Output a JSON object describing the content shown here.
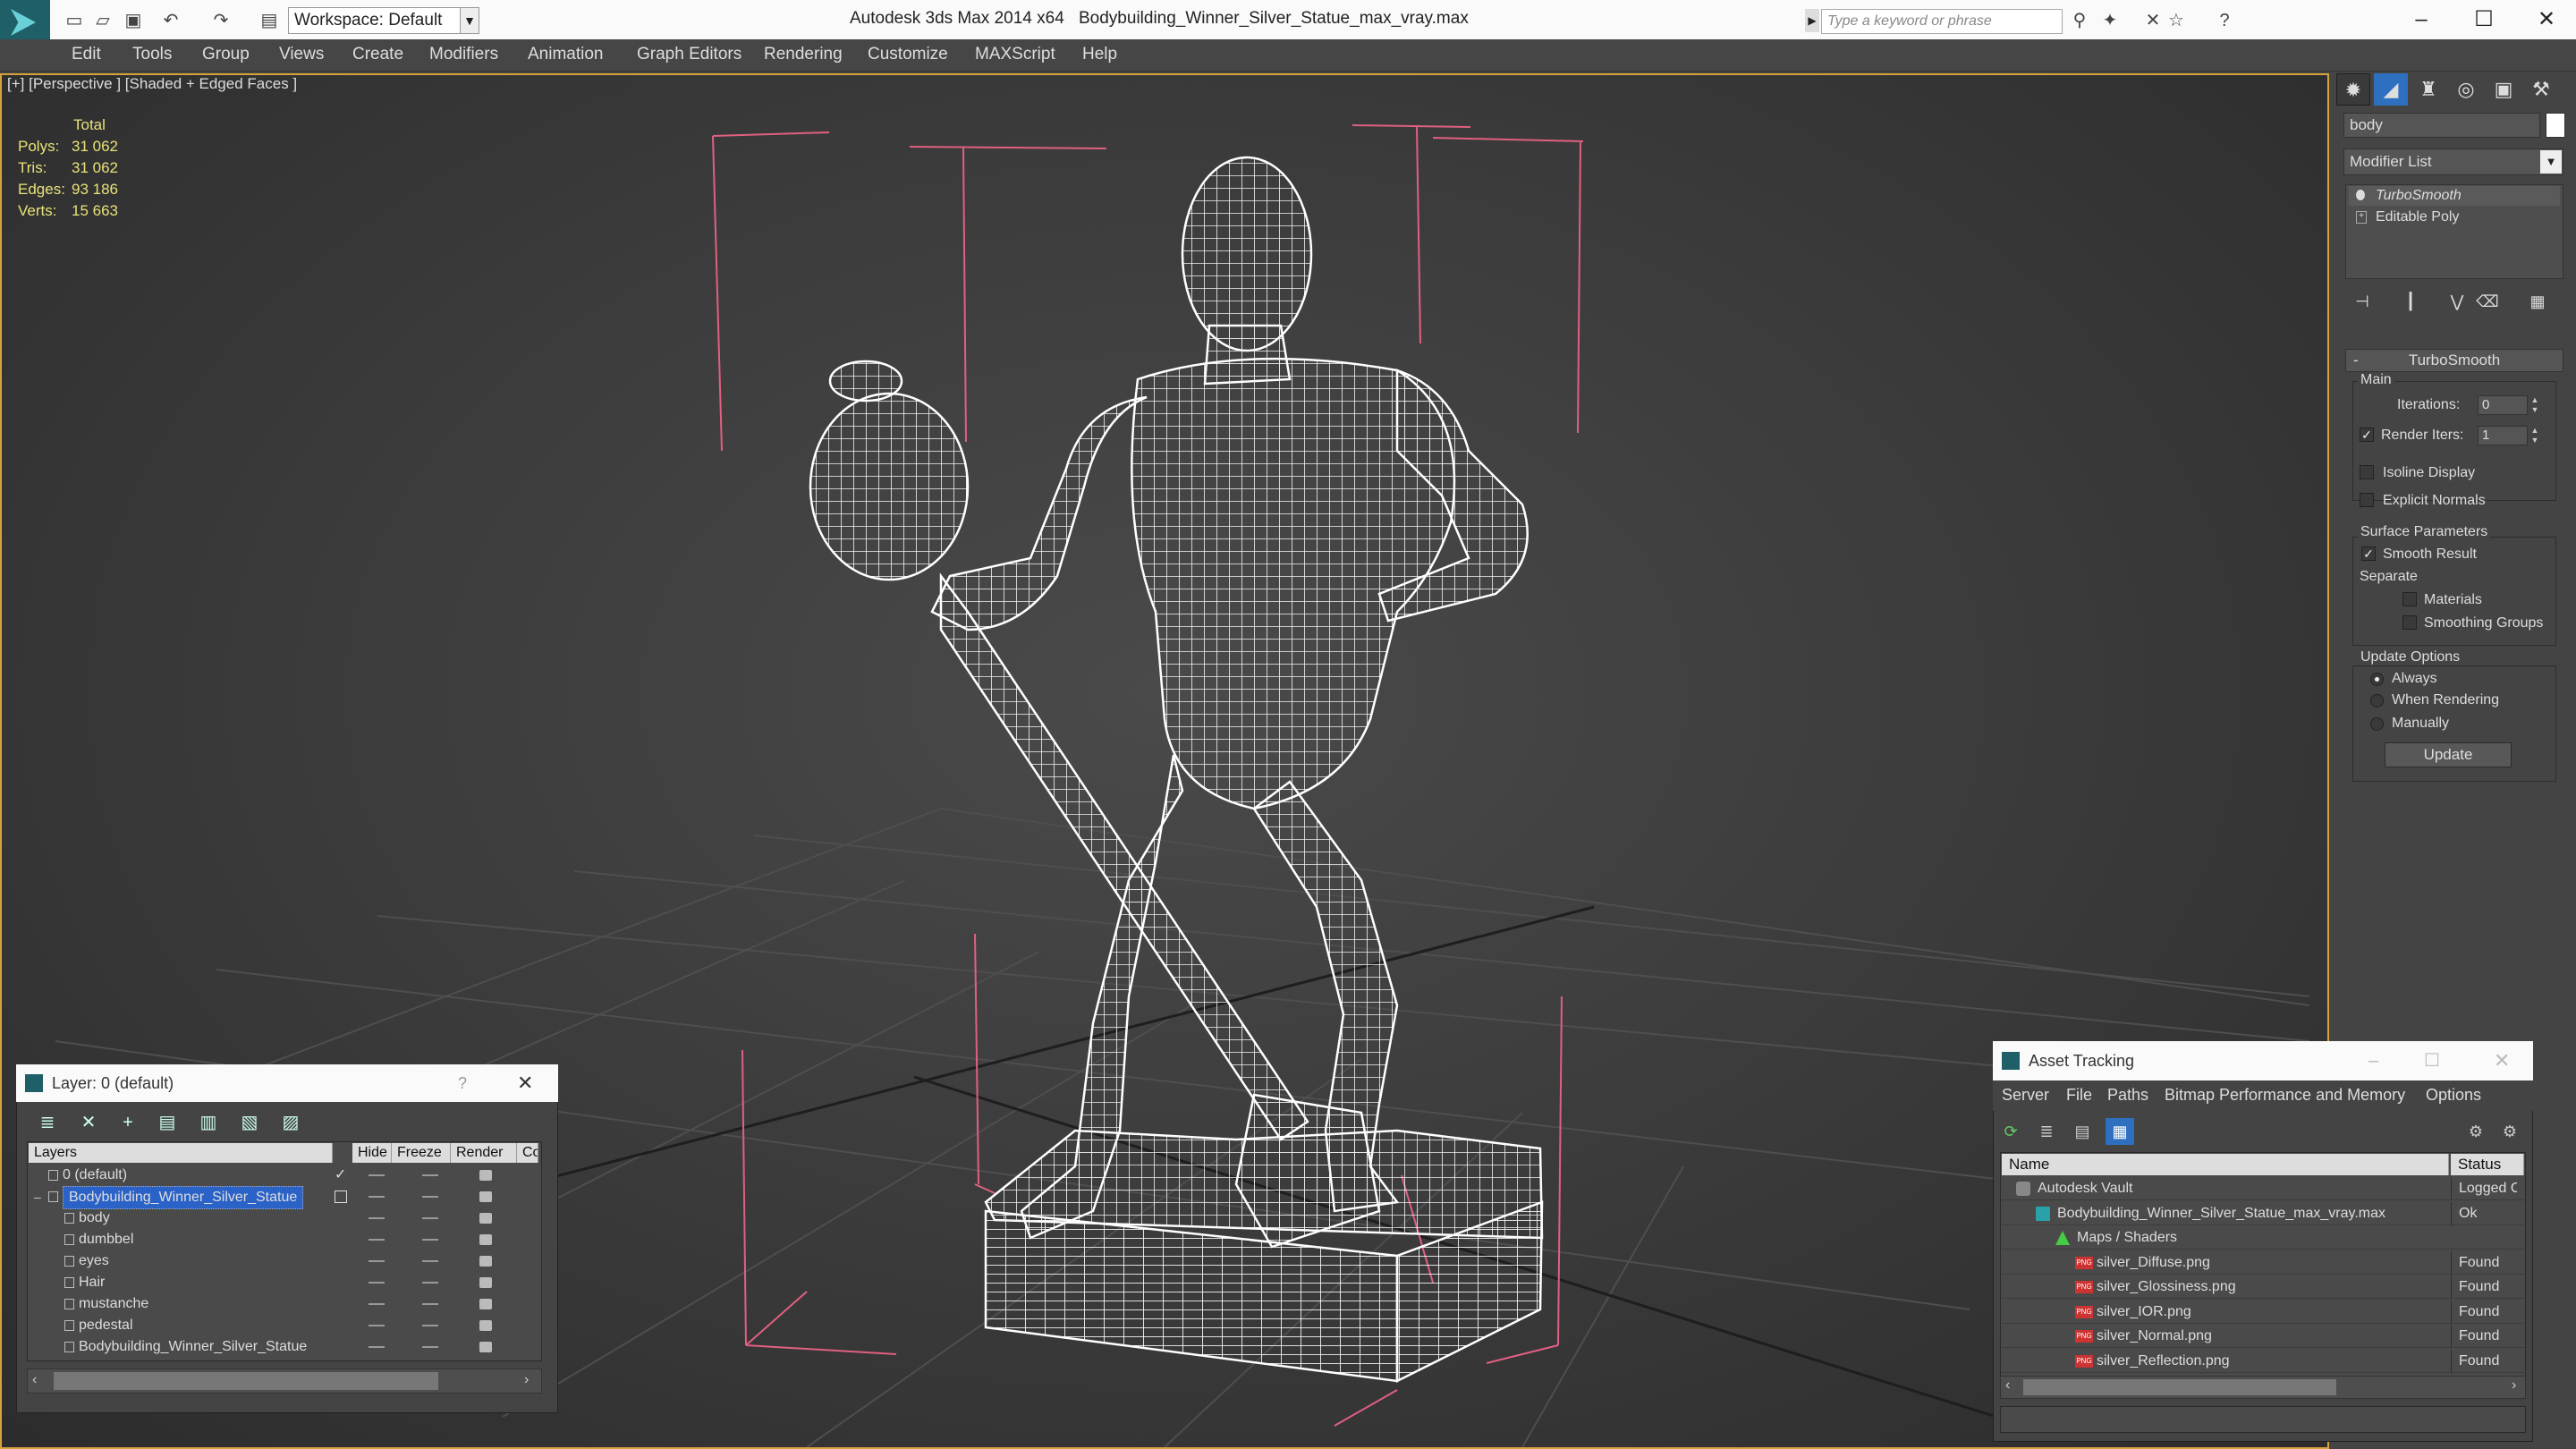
{
  "titlebar": {
    "workspace": "Workspace: Default",
    "app_title": "Autodesk 3ds Max  2014 x64",
    "file_title": "Bodybuilding_Winner_Silver_Statue_max_vray.max",
    "search_placeholder": "Type a keyword or phrase"
  },
  "menu": [
    "Edit",
    "Tools",
    "Group",
    "Views",
    "Create",
    "Modifiers",
    "Animation",
    "Graph Editors",
    "Rendering",
    "Customize",
    "MAXScript",
    "Help"
  ],
  "viewport": {
    "label": "[+] [Perspective ] [Shaded + Edged Faces ]",
    "stats": {
      "header": "Total",
      "rows": [
        {
          "label": "Polys:",
          "value": "31 062"
        },
        {
          "label": "Tris:",
          "value": "31 062"
        },
        {
          "label": "Edges:",
          "value": "93 186"
        },
        {
          "label": "Verts:",
          "value": "15 663"
        }
      ]
    }
  },
  "command_panel": {
    "object_name": "body",
    "modifier_list": "Modifier List",
    "stack": [
      "TurboSmooth",
      "Editable Poly"
    ],
    "turbosmooth": {
      "title": "TurboSmooth",
      "main": "Main",
      "iterations_label": "Iterations:",
      "iterations_value": "0",
      "render_iters_label": "Render Iters:",
      "render_iters_value": "1",
      "isoline_display": "Isoline Display",
      "explicit_normals": "Explicit Normals",
      "surface_parameters": "Surface Parameters",
      "smooth_result": "Smooth Result",
      "separate": "Separate",
      "materials": "Materials",
      "smoothing_groups": "Smoothing Groups",
      "update_options": "Update Options",
      "always": "Always",
      "when_rendering": "When Rendering",
      "manually": "Manually",
      "update": "Update"
    }
  },
  "layer_window": {
    "title": "Layer: 0 (default)",
    "help": "?",
    "columns": [
      "Layers",
      "Hide",
      "Freeze",
      "Render",
      "Co"
    ],
    "rows": [
      {
        "name": "0 (default)",
        "indent": 1,
        "type": "layer"
      },
      {
        "name": "Bodybuilding_Winner_Silver_Statue",
        "indent": 1,
        "type": "layer",
        "selected": true
      },
      {
        "name": "body",
        "indent": 2,
        "type": "object"
      },
      {
        "name": "dumbbel",
        "indent": 2,
        "type": "object"
      },
      {
        "name": "eyes",
        "indent": 2,
        "type": "object"
      },
      {
        "name": "Hair",
        "indent": 2,
        "type": "object"
      },
      {
        "name": "mustanche",
        "indent": 2,
        "type": "object"
      },
      {
        "name": "pedestal",
        "indent": 2,
        "type": "object"
      },
      {
        "name": "Bodybuilding_Winner_Silver_Statue",
        "indent": 2,
        "type": "object"
      }
    ]
  },
  "asset_tracking": {
    "title": "Asset Tracking",
    "menu": [
      "Server",
      "File",
      "Paths",
      "Bitmap Performance and Memory",
      "Options"
    ],
    "columns": [
      "Name",
      "Status"
    ],
    "rows": [
      {
        "name": "Autodesk Vault",
        "status": "Logged O",
        "indent": 0,
        "icon": "vault"
      },
      {
        "name": "Bodybuilding_Winner_Silver_Statue_max_vray.max",
        "status": "Ok",
        "indent": 1,
        "icon": "max"
      },
      {
        "name": "Maps / Shaders",
        "status": "",
        "indent": 2,
        "icon": "maps"
      },
      {
        "name": "silver_Diffuse.png",
        "status": "Found",
        "indent": 3,
        "icon": "png"
      },
      {
        "name": "silver_Glossiness.png",
        "status": "Found",
        "indent": 3,
        "icon": "png"
      },
      {
        "name": "silver_IOR.png",
        "status": "Found",
        "indent": 3,
        "icon": "png"
      },
      {
        "name": "silver_Normal.png",
        "status": "Found",
        "indent": 3,
        "icon": "png"
      },
      {
        "name": "silver_Reflection.png",
        "status": "Found",
        "indent": 3,
        "icon": "png"
      }
    ]
  },
  "colors": {
    "viewport_border": "#d6a23c",
    "stats_text": "#e8e27a",
    "selection": "#2a62c8",
    "bbox_lines": "#e06080",
    "wire": "#ffffff"
  }
}
